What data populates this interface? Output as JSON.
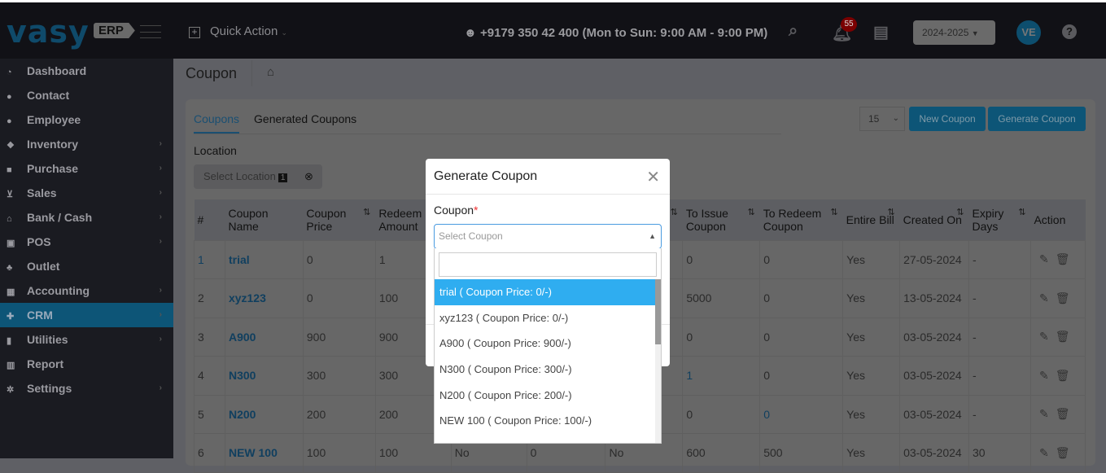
{
  "header": {
    "logo": "vasy",
    "logo_badge": "ERP",
    "quick_action": "Quick Action",
    "phone": "+9179 350 42 400 (Mon to Sun: 9:00 AM - 9:00 PM)",
    "notification_count": "55",
    "year": "2024-2025",
    "avatar": "VE",
    "help": "?"
  },
  "sidebar": {
    "items": [
      {
        "label": "Dashboard",
        "icon": "dashboard-icon"
      },
      {
        "label": "Contact",
        "icon": "user-icon"
      },
      {
        "label": "Employee",
        "icon": "user-icon"
      },
      {
        "label": "Inventory",
        "icon": "cubes-icon",
        "chevron": true
      },
      {
        "label": "Purchase",
        "icon": "briefcase-icon",
        "chevron": true
      },
      {
        "label": "Sales",
        "icon": "cart-icon",
        "chevron": true
      },
      {
        "label": "Bank / Cash",
        "icon": "bank-icon",
        "chevron": true
      },
      {
        "label": "POS",
        "icon": "pos-icon",
        "chevron": true
      },
      {
        "label": "Outlet",
        "icon": "sitemap-icon"
      },
      {
        "label": "Accounting",
        "icon": "calculator-icon",
        "chevron": true
      },
      {
        "label": "CRM",
        "icon": "gift-icon",
        "chevron": true,
        "active": true
      },
      {
        "label": "Utilities",
        "icon": "file-icon",
        "chevron": true
      },
      {
        "label": "Report",
        "icon": "chart-icon"
      },
      {
        "label": "Settings",
        "icon": "gears-icon",
        "chevron": true
      }
    ]
  },
  "page": {
    "title": "Coupon",
    "tabs": [
      "Coupons",
      "Generated Coupons"
    ],
    "location_label": "Location",
    "location_placeholder": "Select Location",
    "location_count": "1",
    "page_size": "15",
    "new_coupon": "New Coupon",
    "generate_coupon": "Generate Coupon"
  },
  "table": {
    "headers": [
      "#",
      "Coupon Name",
      "Coupon Price",
      "Redeem Amount",
      "",
      "",
      "",
      "To Issue Coupon",
      "To Redeem Coupon",
      "Entire Bill",
      "Created On",
      "Expiry Days",
      "Action"
    ],
    "rows": [
      [
        "1",
        "trial",
        "0",
        "1",
        "",
        "",
        "",
        "0",
        "0",
        "Yes",
        "27-05-2024",
        "-"
      ],
      [
        "2",
        "xyz123",
        "0",
        "100",
        "",
        "",
        "",
        "5000",
        "0",
        "Yes",
        "13-05-2024",
        "-"
      ],
      [
        "3",
        "A900",
        "900",
        "900",
        "",
        "",
        "",
        "0",
        "0",
        "Yes",
        "03-05-2024",
        "-"
      ],
      [
        "4",
        "N300",
        "300",
        "300",
        "",
        "",
        "",
        "1",
        "0",
        "Yes",
        "03-05-2024",
        "-"
      ],
      [
        "5",
        "N200",
        "200",
        "200",
        "",
        "",
        "",
        "0",
        "0",
        "Yes",
        "03-05-2024",
        "-"
      ],
      [
        "6",
        "NEW 100",
        "100",
        "100",
        "No",
        "0",
        "No",
        "600",
        "500",
        "Yes",
        "03-05-2024",
        "30"
      ]
    ]
  },
  "modal": {
    "title": "Generate Coupon",
    "coupon_label": "Coupon",
    "required": "*",
    "placeholder": "Select Coupon",
    "options": [
      "trial ( Coupon Price: 0/-)",
      "xyz123 ( Coupon Price: 0/-)",
      "A900 ( Coupon Price: 900/-)",
      "N300 ( Coupon Price: 300/-)",
      "N200 ( Coupon Price: 200/-)",
      "NEW 100 ( Coupon Price: 100/-)"
    ],
    "selected_index": 0
  }
}
